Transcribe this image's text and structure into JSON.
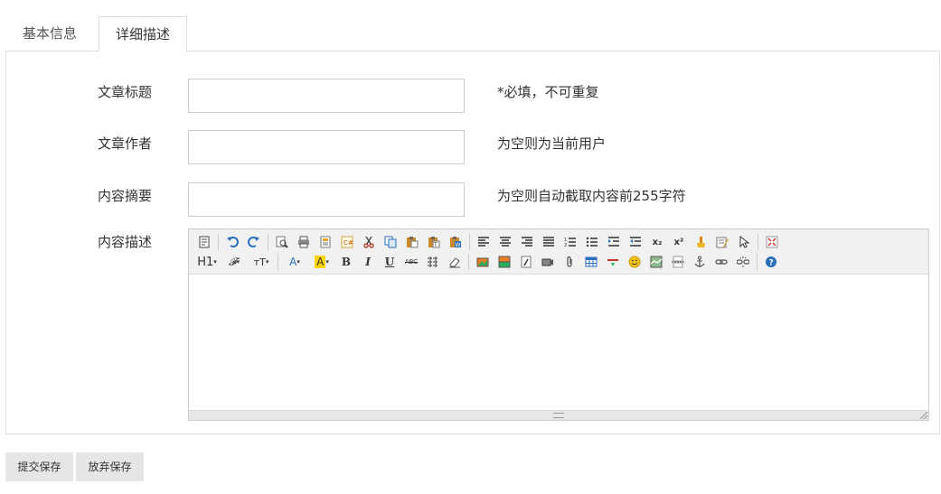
{
  "tabs": [
    {
      "label": "基本信息",
      "active": false
    },
    {
      "label": "详细描述",
      "active": true
    }
  ],
  "form": {
    "title": {
      "label": "文章标题",
      "value": "",
      "hint": "*必填，不可重复"
    },
    "author": {
      "label": "文章作者",
      "value": "",
      "hint": "为空则为当前用户"
    },
    "summary": {
      "label": "内容摘要",
      "value": "",
      "hint": "为空则自动截取内容前255字符"
    },
    "description": {
      "label": "内容描述"
    }
  },
  "editor": {
    "toolbar_row1": [
      "source-icon",
      "undo-icon",
      "redo-icon",
      "preview-icon",
      "print-icon",
      "template-icon",
      "code-icon",
      "cut-icon",
      "copy-icon",
      "paste-icon",
      "paste-text-icon",
      "paste-word-icon",
      "align-left-icon",
      "align-center-icon",
      "align-right-icon",
      "align-justify-icon",
      "ordered-list-icon",
      "unordered-list-icon",
      "indent-icon",
      "outdent-icon",
      "subscript-icon",
      "superscript-icon",
      "clear-format-icon",
      "select-all-icon",
      "select-icon",
      "fullscreen-icon"
    ],
    "toolbar_row2": [
      "heading-icon",
      "font-family-icon",
      "font-size-icon",
      "font-color-icon",
      "highlight-icon",
      "bold-icon",
      "italic-icon",
      "underline-icon",
      "strikethrough-icon",
      "line-height-icon",
      "remove-format-icon",
      "image-icon",
      "multi-image-icon",
      "flash-icon",
      "media-icon",
      "attachment-icon",
      "table-icon",
      "hr-icon",
      "emoticon-icon",
      "baidu-map-icon",
      "page-break-icon",
      "anchor-icon",
      "link-icon",
      "unlink-icon",
      "help-icon"
    ],
    "glyphs": {
      "heading": "H1",
      "font_family": "𝓕",
      "font_size": "тT",
      "font_color": "A",
      "highlight": "A",
      "bold": "B",
      "italic": "I",
      "underline": "U",
      "strikethrough": "ABC",
      "subscript": "x₂",
      "superscript": "x²"
    }
  },
  "buttons": {
    "submit": "提交保存",
    "discard": "放弃保存"
  }
}
